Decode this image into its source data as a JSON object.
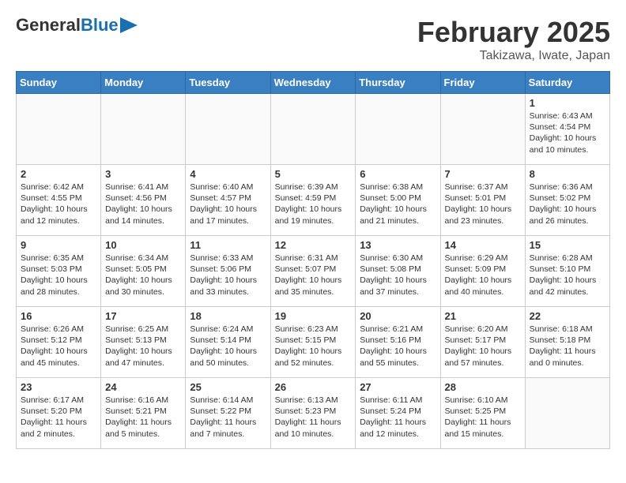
{
  "header": {
    "logo_line1": "General",
    "logo_line2": "Blue",
    "month": "February 2025",
    "location": "Takizawa, Iwate, Japan"
  },
  "weekdays": [
    "Sunday",
    "Monday",
    "Tuesday",
    "Wednesday",
    "Thursday",
    "Friday",
    "Saturday"
  ],
  "weeks": [
    [
      {
        "day": "",
        "info": ""
      },
      {
        "day": "",
        "info": ""
      },
      {
        "day": "",
        "info": ""
      },
      {
        "day": "",
        "info": ""
      },
      {
        "day": "",
        "info": ""
      },
      {
        "day": "",
        "info": ""
      },
      {
        "day": "1",
        "info": "Sunrise: 6:43 AM\nSunset: 4:54 PM\nDaylight: 10 hours\nand 10 minutes."
      }
    ],
    [
      {
        "day": "2",
        "info": "Sunrise: 6:42 AM\nSunset: 4:55 PM\nDaylight: 10 hours\nand 12 minutes."
      },
      {
        "day": "3",
        "info": "Sunrise: 6:41 AM\nSunset: 4:56 PM\nDaylight: 10 hours\nand 14 minutes."
      },
      {
        "day": "4",
        "info": "Sunrise: 6:40 AM\nSunset: 4:57 PM\nDaylight: 10 hours\nand 17 minutes."
      },
      {
        "day": "5",
        "info": "Sunrise: 6:39 AM\nSunset: 4:59 PM\nDaylight: 10 hours\nand 19 minutes."
      },
      {
        "day": "6",
        "info": "Sunrise: 6:38 AM\nSunset: 5:00 PM\nDaylight: 10 hours\nand 21 minutes."
      },
      {
        "day": "7",
        "info": "Sunrise: 6:37 AM\nSunset: 5:01 PM\nDaylight: 10 hours\nand 23 minutes."
      },
      {
        "day": "8",
        "info": "Sunrise: 6:36 AM\nSunset: 5:02 PM\nDaylight: 10 hours\nand 26 minutes."
      }
    ],
    [
      {
        "day": "9",
        "info": "Sunrise: 6:35 AM\nSunset: 5:03 PM\nDaylight: 10 hours\nand 28 minutes."
      },
      {
        "day": "10",
        "info": "Sunrise: 6:34 AM\nSunset: 5:05 PM\nDaylight: 10 hours\nand 30 minutes."
      },
      {
        "day": "11",
        "info": "Sunrise: 6:33 AM\nSunset: 5:06 PM\nDaylight: 10 hours\nand 33 minutes."
      },
      {
        "day": "12",
        "info": "Sunrise: 6:31 AM\nSunset: 5:07 PM\nDaylight: 10 hours\nand 35 minutes."
      },
      {
        "day": "13",
        "info": "Sunrise: 6:30 AM\nSunset: 5:08 PM\nDaylight: 10 hours\nand 37 minutes."
      },
      {
        "day": "14",
        "info": "Sunrise: 6:29 AM\nSunset: 5:09 PM\nDaylight: 10 hours\nand 40 minutes."
      },
      {
        "day": "15",
        "info": "Sunrise: 6:28 AM\nSunset: 5:10 PM\nDaylight: 10 hours\nand 42 minutes."
      }
    ],
    [
      {
        "day": "16",
        "info": "Sunrise: 6:26 AM\nSunset: 5:12 PM\nDaylight: 10 hours\nand 45 minutes."
      },
      {
        "day": "17",
        "info": "Sunrise: 6:25 AM\nSunset: 5:13 PM\nDaylight: 10 hours\nand 47 minutes."
      },
      {
        "day": "18",
        "info": "Sunrise: 6:24 AM\nSunset: 5:14 PM\nDaylight: 10 hours\nand 50 minutes."
      },
      {
        "day": "19",
        "info": "Sunrise: 6:23 AM\nSunset: 5:15 PM\nDaylight: 10 hours\nand 52 minutes."
      },
      {
        "day": "20",
        "info": "Sunrise: 6:21 AM\nSunset: 5:16 PM\nDaylight: 10 hours\nand 55 minutes."
      },
      {
        "day": "21",
        "info": "Sunrise: 6:20 AM\nSunset: 5:17 PM\nDaylight: 10 hours\nand 57 minutes."
      },
      {
        "day": "22",
        "info": "Sunrise: 6:18 AM\nSunset: 5:18 PM\nDaylight: 11 hours\nand 0 minutes."
      }
    ],
    [
      {
        "day": "23",
        "info": "Sunrise: 6:17 AM\nSunset: 5:20 PM\nDaylight: 11 hours\nand 2 minutes."
      },
      {
        "day": "24",
        "info": "Sunrise: 6:16 AM\nSunset: 5:21 PM\nDaylight: 11 hours\nand 5 minutes."
      },
      {
        "day": "25",
        "info": "Sunrise: 6:14 AM\nSunset: 5:22 PM\nDaylight: 11 hours\nand 7 minutes."
      },
      {
        "day": "26",
        "info": "Sunrise: 6:13 AM\nSunset: 5:23 PM\nDaylight: 11 hours\nand 10 minutes."
      },
      {
        "day": "27",
        "info": "Sunrise: 6:11 AM\nSunset: 5:24 PM\nDaylight: 11 hours\nand 12 minutes."
      },
      {
        "day": "28",
        "info": "Sunrise: 6:10 AM\nSunset: 5:25 PM\nDaylight: 11 hours\nand 15 minutes."
      },
      {
        "day": "",
        "info": ""
      }
    ]
  ]
}
